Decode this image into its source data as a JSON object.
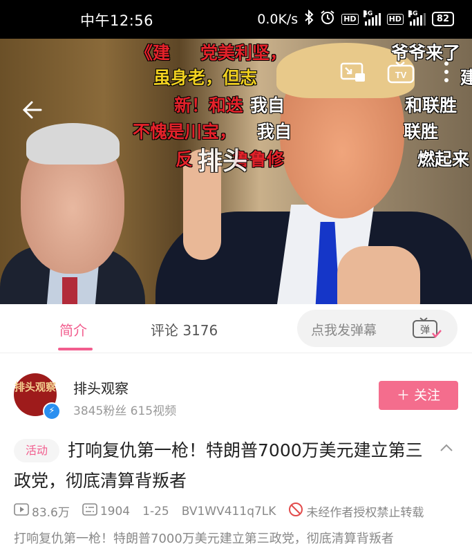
{
  "status_bar": {
    "time": "中午12:56",
    "net_speed": "0.0K/s",
    "battery": "82",
    "network_1": "4G",
    "network_2": "4G",
    "hd_1": "HD",
    "hd_2": "HD"
  },
  "video": {
    "danmaku": [
      {
        "text": "《建",
        "color": "red"
      },
      {
        "text": "党美利坚，",
        "color": "red"
      },
      {
        "text": "爷爷来了",
        "color": "wht"
      },
      {
        "text": "虽身老，但志",
        "color": "yel"
      },
      {
        "text": "新！和迭",
        "color": "red"
      },
      {
        "text": "我自",
        "color": "wht"
      },
      {
        "text": "和联胜",
        "color": "wht"
      },
      {
        "text": "不愧是川宝，",
        "color": "red"
      },
      {
        "text": "我自",
        "color": "wht"
      },
      {
        "text": "联胜",
        "color": "wht"
      },
      {
        "text": "反",
        "color": "red"
      },
      {
        "text": "鲁鲁修",
        "color": "red"
      },
      {
        "text": "燃起来",
        "color": "wht"
      },
      {
        "text": "建",
        "color": "wht"
      }
    ],
    "watermark": "排头",
    "tv_label": "TV"
  },
  "tabs": {
    "intro": "简介",
    "comments": "评论 3176"
  },
  "danmaku_input": {
    "placeholder": "点我发弹幕",
    "icon_label": "弹"
  },
  "uploader": {
    "avatar_text": "排头观察",
    "name": "排头观察",
    "stats": "3845粉丝   615视频",
    "follow_label": "＋ 关注"
  },
  "video_info": {
    "tag": "活动",
    "title": "打响复仇第一枪！特朗普7000万美元建立第三政党，彻底清算背叛者",
    "plays": "83.6万",
    "danmaku_count": "1904",
    "date": "1-25",
    "bvid": "BV1WV411q7LK",
    "copyright": "未经作者授权禁止转载",
    "description": "打响复仇第一枪！特朗普7000万美元建立第三政党，彻底清算背叛者"
  },
  "colors": {
    "accent": "#f25d8e",
    "follow_bg": "#f46d8d",
    "status_bar_bg": "#000000"
  }
}
